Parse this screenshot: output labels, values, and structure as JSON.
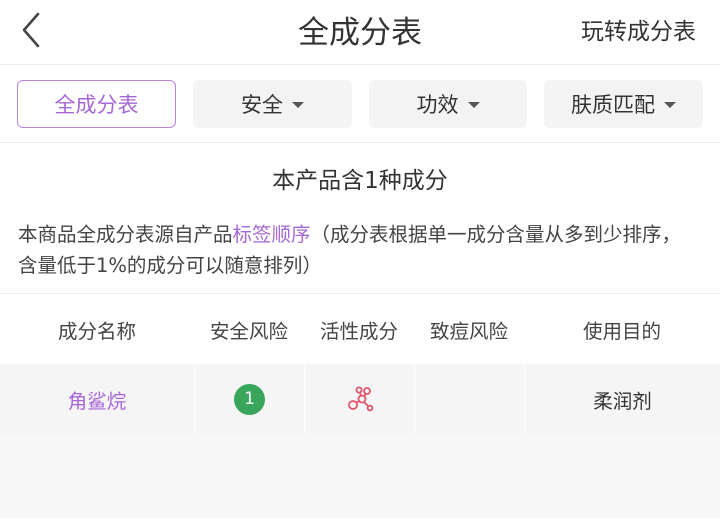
{
  "header": {
    "title": "全成分表",
    "right_link": "玩转成分表",
    "back_icon": "chevron-left-icon"
  },
  "filters": [
    {
      "label": "全成分表",
      "active": true,
      "has_dropdown": false
    },
    {
      "label": "安全",
      "active": false,
      "has_dropdown": true
    },
    {
      "label": "功效",
      "active": false,
      "has_dropdown": true
    },
    {
      "label": "肤质匹配",
      "active": false,
      "has_dropdown": true
    }
  ],
  "summary": {
    "count_text": "本产品含1种成分",
    "desc_prefix": "本商品全成分表源自产品",
    "desc_link": "标签顺序",
    "desc_suffix": "（成分表根据单一成分含量从多到少排序，含量低于1%的成分可以随意排列）"
  },
  "table": {
    "columns": [
      "成分名称",
      "安全风险",
      "活性成分",
      "致痘风险",
      "使用目的"
    ],
    "rows": [
      {
        "name": "角鲨烷",
        "safety_score": "1",
        "active_icon": "molecule-icon",
        "acne_risk": "",
        "purpose": "柔润剂"
      }
    ]
  },
  "colors": {
    "accent": "#a667d8",
    "safety_green": "#3aa65c",
    "chip_bg": "#f3f3f4"
  }
}
